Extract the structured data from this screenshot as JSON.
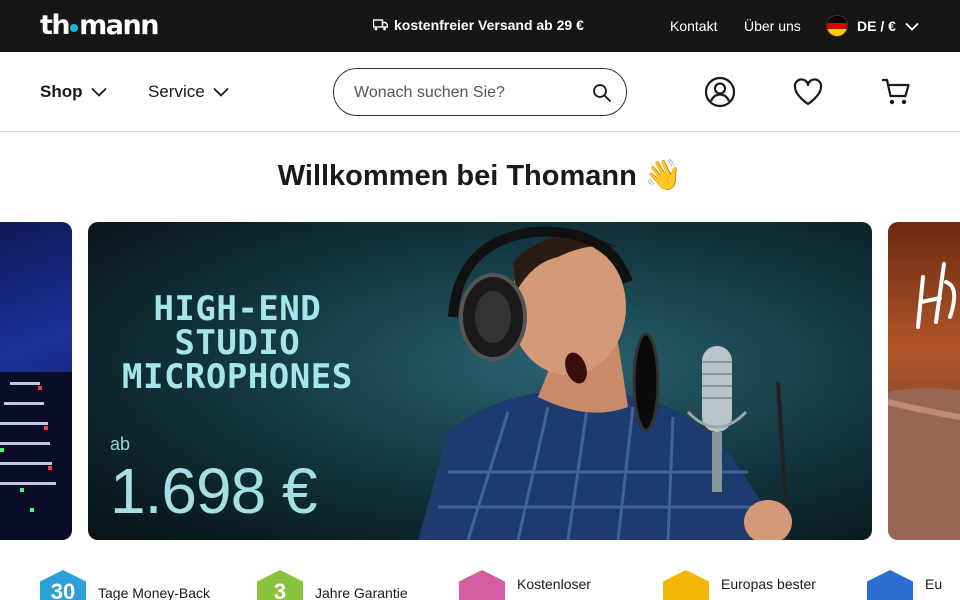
{
  "topbar": {
    "logo": "thomann",
    "logo_left": "th",
    "logo_right": "mann",
    "shipping": "kostenfreier Versand ab 29 €",
    "links": [
      "Kontakt",
      "Über uns"
    ],
    "locale": "DE / €"
  },
  "nav": {
    "shop": "Shop",
    "service": "Service",
    "search_placeholder": "Wonach suchen Sie?"
  },
  "welcome": {
    "title": "Willkommen bei Thomann",
    "emoji": "👋"
  },
  "hero": {
    "title_lines": [
      "HIGH-END",
      "STUDIO",
      "MICROPHONES"
    ],
    "ab": "ab",
    "price": "1.698 €"
  },
  "features": [
    {
      "badge": "30",
      "label": "Tage Money-Back",
      "color": "#2f9fd8"
    },
    {
      "badge": "3",
      "label": "Jahre Garantie",
      "color": "#8ac43f"
    },
    {
      "badge": "",
      "label": "Kostenloser",
      "color": "#d35da0"
    },
    {
      "badge": "",
      "label": "Europas bester",
      "color": "#f2b705"
    },
    {
      "badge": "",
      "label": "Eu",
      "color": "#2a6fd0"
    }
  ],
  "colors": {
    "topbar_bg": "#161616",
    "accent": "#13b5d8",
    "hero_text": "#a5e6ea"
  }
}
